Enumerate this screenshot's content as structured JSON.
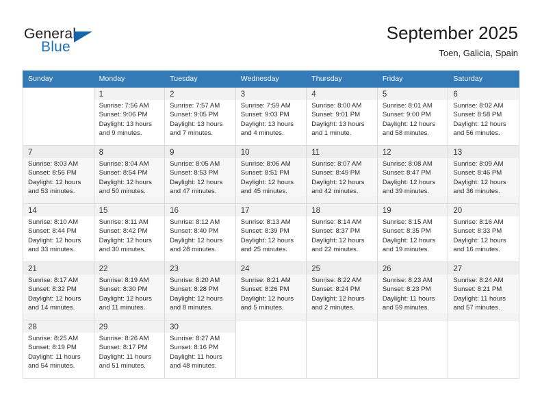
{
  "brand": {
    "name_part1": "General",
    "name_part2": "Blue",
    "accent_color": "#1565a8"
  },
  "header": {
    "month_title": "September 2025",
    "location": "Toen, Galicia, Spain"
  },
  "calendar": {
    "header_color": "#337ab7",
    "weekday_headers": [
      "Sunday",
      "Monday",
      "Tuesday",
      "Wednesday",
      "Thursday",
      "Friday",
      "Saturday"
    ],
    "weeks": [
      [
        {
          "day": "",
          "sunrise": "",
          "sunset": "",
          "daylight": ""
        },
        {
          "day": "1",
          "sunrise": "Sunrise: 7:56 AM",
          "sunset": "Sunset: 9:06 PM",
          "daylight": "Daylight: 13 hours and 9 minutes."
        },
        {
          "day": "2",
          "sunrise": "Sunrise: 7:57 AM",
          "sunset": "Sunset: 9:05 PM",
          "daylight": "Daylight: 13 hours and 7 minutes."
        },
        {
          "day": "3",
          "sunrise": "Sunrise: 7:59 AM",
          "sunset": "Sunset: 9:03 PM",
          "daylight": "Daylight: 13 hours and 4 minutes."
        },
        {
          "day": "4",
          "sunrise": "Sunrise: 8:00 AM",
          "sunset": "Sunset: 9:01 PM",
          "daylight": "Daylight: 13 hours and 1 minute."
        },
        {
          "day": "5",
          "sunrise": "Sunrise: 8:01 AM",
          "sunset": "Sunset: 9:00 PM",
          "daylight": "Daylight: 12 hours and 58 minutes."
        },
        {
          "day": "6",
          "sunrise": "Sunrise: 8:02 AM",
          "sunset": "Sunset: 8:58 PM",
          "daylight": "Daylight: 12 hours and 56 minutes."
        }
      ],
      [
        {
          "day": "7",
          "sunrise": "Sunrise: 8:03 AM",
          "sunset": "Sunset: 8:56 PM",
          "daylight": "Daylight: 12 hours and 53 minutes."
        },
        {
          "day": "8",
          "sunrise": "Sunrise: 8:04 AM",
          "sunset": "Sunset: 8:54 PM",
          "daylight": "Daylight: 12 hours and 50 minutes."
        },
        {
          "day": "9",
          "sunrise": "Sunrise: 8:05 AM",
          "sunset": "Sunset: 8:53 PM",
          "daylight": "Daylight: 12 hours and 47 minutes."
        },
        {
          "day": "10",
          "sunrise": "Sunrise: 8:06 AM",
          "sunset": "Sunset: 8:51 PM",
          "daylight": "Daylight: 12 hours and 45 minutes."
        },
        {
          "day": "11",
          "sunrise": "Sunrise: 8:07 AM",
          "sunset": "Sunset: 8:49 PM",
          "daylight": "Daylight: 12 hours and 42 minutes."
        },
        {
          "day": "12",
          "sunrise": "Sunrise: 8:08 AM",
          "sunset": "Sunset: 8:47 PM",
          "daylight": "Daylight: 12 hours and 39 minutes."
        },
        {
          "day": "13",
          "sunrise": "Sunrise: 8:09 AM",
          "sunset": "Sunset: 8:46 PM",
          "daylight": "Daylight: 12 hours and 36 minutes."
        }
      ],
      [
        {
          "day": "14",
          "sunrise": "Sunrise: 8:10 AM",
          "sunset": "Sunset: 8:44 PM",
          "daylight": "Daylight: 12 hours and 33 minutes."
        },
        {
          "day": "15",
          "sunrise": "Sunrise: 8:11 AM",
          "sunset": "Sunset: 8:42 PM",
          "daylight": "Daylight: 12 hours and 30 minutes."
        },
        {
          "day": "16",
          "sunrise": "Sunrise: 8:12 AM",
          "sunset": "Sunset: 8:40 PM",
          "daylight": "Daylight: 12 hours and 28 minutes."
        },
        {
          "day": "17",
          "sunrise": "Sunrise: 8:13 AM",
          "sunset": "Sunset: 8:39 PM",
          "daylight": "Daylight: 12 hours and 25 minutes."
        },
        {
          "day": "18",
          "sunrise": "Sunrise: 8:14 AM",
          "sunset": "Sunset: 8:37 PM",
          "daylight": "Daylight: 12 hours and 22 minutes."
        },
        {
          "day": "19",
          "sunrise": "Sunrise: 8:15 AM",
          "sunset": "Sunset: 8:35 PM",
          "daylight": "Daylight: 12 hours and 19 minutes."
        },
        {
          "day": "20",
          "sunrise": "Sunrise: 8:16 AM",
          "sunset": "Sunset: 8:33 PM",
          "daylight": "Daylight: 12 hours and 16 minutes."
        }
      ],
      [
        {
          "day": "21",
          "sunrise": "Sunrise: 8:17 AM",
          "sunset": "Sunset: 8:32 PM",
          "daylight": "Daylight: 12 hours and 14 minutes."
        },
        {
          "day": "22",
          "sunrise": "Sunrise: 8:19 AM",
          "sunset": "Sunset: 8:30 PM",
          "daylight": "Daylight: 12 hours and 11 minutes."
        },
        {
          "day": "23",
          "sunrise": "Sunrise: 8:20 AM",
          "sunset": "Sunset: 8:28 PM",
          "daylight": "Daylight: 12 hours and 8 minutes."
        },
        {
          "day": "24",
          "sunrise": "Sunrise: 8:21 AM",
          "sunset": "Sunset: 8:26 PM",
          "daylight": "Daylight: 12 hours and 5 minutes."
        },
        {
          "day": "25",
          "sunrise": "Sunrise: 8:22 AM",
          "sunset": "Sunset: 8:24 PM",
          "daylight": "Daylight: 12 hours and 2 minutes."
        },
        {
          "day": "26",
          "sunrise": "Sunrise: 8:23 AM",
          "sunset": "Sunset: 8:23 PM",
          "daylight": "Daylight: 11 hours and 59 minutes."
        },
        {
          "day": "27",
          "sunrise": "Sunrise: 8:24 AM",
          "sunset": "Sunset: 8:21 PM",
          "daylight": "Daylight: 11 hours and 57 minutes."
        }
      ],
      [
        {
          "day": "28",
          "sunrise": "Sunrise: 8:25 AM",
          "sunset": "Sunset: 8:19 PM",
          "daylight": "Daylight: 11 hours and 54 minutes."
        },
        {
          "day": "29",
          "sunrise": "Sunrise: 8:26 AM",
          "sunset": "Sunset: 8:17 PM",
          "daylight": "Daylight: 11 hours and 51 minutes."
        },
        {
          "day": "30",
          "sunrise": "Sunrise: 8:27 AM",
          "sunset": "Sunset: 8:16 PM",
          "daylight": "Daylight: 11 hours and 48 minutes."
        },
        {
          "day": "",
          "sunrise": "",
          "sunset": "",
          "daylight": ""
        },
        {
          "day": "",
          "sunrise": "",
          "sunset": "",
          "daylight": ""
        },
        {
          "day": "",
          "sunrise": "",
          "sunset": "",
          "daylight": ""
        },
        {
          "day": "",
          "sunrise": "",
          "sunset": "",
          "daylight": ""
        }
      ]
    ]
  }
}
